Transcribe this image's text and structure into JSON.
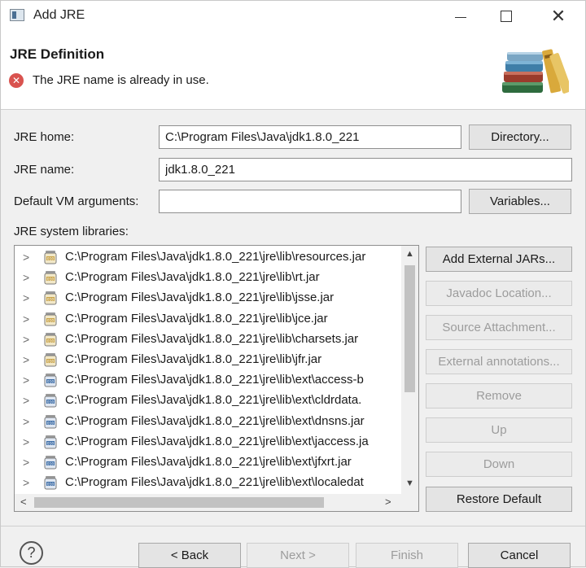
{
  "window": {
    "title": "Add JRE"
  },
  "header": {
    "title": "JRE Definition",
    "error_message": "The JRE name is already in use."
  },
  "form": {
    "jre_home_label": "JRE home:",
    "jre_home_value": "C:\\Program Files\\Java\\jdk1.8.0_221",
    "directory_button": "Directory...",
    "jre_name_label": "JRE name:",
    "jre_name_value": "jdk1.8.0_221",
    "vm_args_label": "Default VM arguments:",
    "vm_args_value": "",
    "variables_button": "Variables...",
    "libraries_label": "JRE system libraries:"
  },
  "libraries": [
    "C:\\Program Files\\Java\\jdk1.8.0_221\\jre\\lib\\resources.jar",
    "C:\\Program Files\\Java\\jdk1.8.0_221\\jre\\lib\\rt.jar",
    "C:\\Program Files\\Java\\jdk1.8.0_221\\jre\\lib\\jsse.jar",
    "C:\\Program Files\\Java\\jdk1.8.0_221\\jre\\lib\\jce.jar",
    "C:\\Program Files\\Java\\jdk1.8.0_221\\jre\\lib\\charsets.jar",
    "C:\\Program Files\\Java\\jdk1.8.0_221\\jre\\lib\\jfr.jar",
    "C:\\Program Files\\Java\\jdk1.8.0_221\\jre\\lib\\ext\\access-b",
    "C:\\Program Files\\Java\\jdk1.8.0_221\\jre\\lib\\ext\\cldrdata.",
    "C:\\Program Files\\Java\\jdk1.8.0_221\\jre\\lib\\ext\\dnsns.jar",
    "C:\\Program Files\\Java\\jdk1.8.0_221\\jre\\lib\\ext\\jaccess.ja",
    "C:\\Program Files\\Java\\jdk1.8.0_221\\jre\\lib\\ext\\jfxrt.jar",
    "C:\\Program Files\\Java\\jdk1.8.0_221\\jre\\lib\\ext\\localedat"
  ],
  "library_buttons": {
    "add_external_jars": "Add External JARs...",
    "javadoc_location": "Javadoc Location...",
    "source_attachment": "Source Attachment...",
    "external_annotations": "External annotations...",
    "remove": "Remove",
    "up": "Up",
    "down": "Down",
    "restore_default": "Restore Default"
  },
  "footer": {
    "back": "< Back",
    "next": "Next >",
    "finish": "Finish",
    "cancel": "Cancel"
  },
  "icons": {
    "window": "window-icon",
    "error": "error-icon",
    "banner": "books-icon",
    "library": "jar-icon",
    "help": "help-icon"
  },
  "colors": {
    "error": "#d9534f",
    "disabled_text": "#9c9c9c"
  }
}
